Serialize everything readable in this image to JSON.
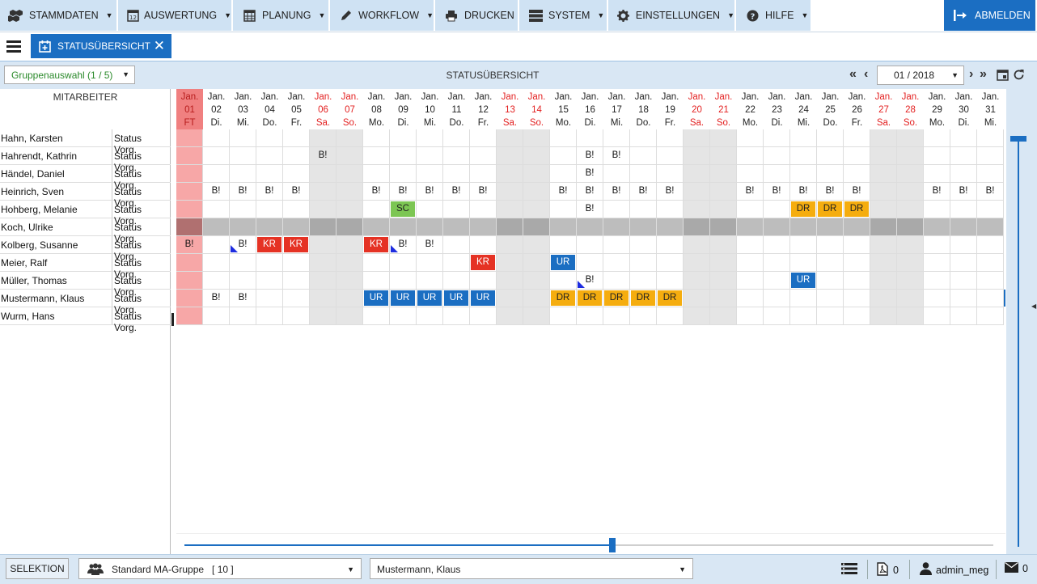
{
  "menu": [
    {
      "label": "STAMMDATEN",
      "icon": "cubes-icon",
      "dropdown": true
    },
    {
      "label": "AUSWERTUNG",
      "icon": "calendar-12-icon",
      "dropdown": true
    },
    {
      "label": "PLANUNG",
      "icon": "calendar-grid-icon",
      "dropdown": true
    },
    {
      "label": "WORKFLOW",
      "icon": "pencil-icon",
      "dropdown": true
    },
    {
      "label": "DRUCKEN",
      "icon": "printer-icon",
      "dropdown": false
    },
    {
      "label": "SYSTEM",
      "icon": "server-icon",
      "dropdown": true
    },
    {
      "label": "EINSTELLUNGEN",
      "icon": "gear-icon",
      "dropdown": true
    },
    {
      "label": "HILFE",
      "icon": "question-circle-icon",
      "dropdown": true
    }
  ],
  "logout_label": "ABMELDEN",
  "tab": {
    "label": "STATUSÜBERSICHT",
    "close": "✕"
  },
  "toolbar": {
    "group_select": "Gruppenauswahl (1 / 5)",
    "title": "STATUSÜBERSICHT",
    "month": "01 / 2018"
  },
  "employee_header": "MITARBEITER",
  "days": [
    {
      "m": "Jan.",
      "d": "01",
      "w": "FT",
      "type": "holiday"
    },
    {
      "m": "Jan.",
      "d": "02",
      "w": "Di.",
      "type": "work"
    },
    {
      "m": "Jan.",
      "d": "03",
      "w": "Mi.",
      "type": "work"
    },
    {
      "m": "Jan.",
      "d": "04",
      "w": "Do.",
      "type": "work"
    },
    {
      "m": "Jan.",
      "d": "05",
      "w": "Fr.",
      "type": "work"
    },
    {
      "m": "Jan.",
      "d": "06",
      "w": "Sa.",
      "type": "weekend"
    },
    {
      "m": "Jan.",
      "d": "07",
      "w": "So.",
      "type": "weekend"
    },
    {
      "m": "Jan.",
      "d": "08",
      "w": "Mo.",
      "type": "work"
    },
    {
      "m": "Jan.",
      "d": "09",
      "w": "Di.",
      "type": "work"
    },
    {
      "m": "Jan.",
      "d": "10",
      "w": "Mi.",
      "type": "work"
    },
    {
      "m": "Jan.",
      "d": "11",
      "w": "Do.",
      "type": "work"
    },
    {
      "m": "Jan.",
      "d": "12",
      "w": "Fr.",
      "type": "work"
    },
    {
      "m": "Jan.",
      "d": "13",
      "w": "Sa.",
      "type": "weekend"
    },
    {
      "m": "Jan.",
      "d": "14",
      "w": "So.",
      "type": "weekend"
    },
    {
      "m": "Jan.",
      "d": "15",
      "w": "Mo.",
      "type": "work"
    },
    {
      "m": "Jan.",
      "d": "16",
      "w": "Di.",
      "type": "work"
    },
    {
      "m": "Jan.",
      "d": "17",
      "w": "Mi.",
      "type": "work"
    },
    {
      "m": "Jan.",
      "d": "18",
      "w": "Do.",
      "type": "work"
    },
    {
      "m": "Jan.",
      "d": "19",
      "w": "Fr.",
      "type": "work"
    },
    {
      "m": "Jan.",
      "d": "20",
      "w": "Sa.",
      "type": "weekend"
    },
    {
      "m": "Jan.",
      "d": "21",
      "w": "So.",
      "type": "weekend"
    },
    {
      "m": "Jan.",
      "d": "22",
      "w": "Mo.",
      "type": "work"
    },
    {
      "m": "Jan.",
      "d": "23",
      "w": "Di.",
      "type": "work"
    },
    {
      "m": "Jan.",
      "d": "24",
      "w": "Mi.",
      "type": "work"
    },
    {
      "m": "Jan.",
      "d": "25",
      "w": "Do.",
      "type": "work"
    },
    {
      "m": "Jan.",
      "d": "26",
      "w": "Fr.",
      "type": "work"
    },
    {
      "m": "Jan.",
      "d": "27",
      "w": "Sa.",
      "type": "weekend"
    },
    {
      "m": "Jan.",
      "d": "28",
      "w": "So.",
      "type": "weekend"
    },
    {
      "m": "Jan.",
      "d": "29",
      "w": "Mo.",
      "type": "work"
    },
    {
      "m": "Jan.",
      "d": "30",
      "w": "Di.",
      "type": "work"
    },
    {
      "m": "Jan.",
      "d": "31",
      "w": "Mi.",
      "type": "work"
    }
  ],
  "employees": [
    {
      "name": "Hahn, Karsten",
      "status": "Status Vorg.",
      "entries": {}
    },
    {
      "name": "Hahrendt, Kathrin",
      "status": "Status Vorg.",
      "entries": {
        "06": "B!",
        "16": "B!",
        "17": "B!"
      }
    },
    {
      "name": "Händel, Daniel",
      "status": "Status Vorg.",
      "entries": {
        "16": "B!"
      }
    },
    {
      "name": "Heinrich, Sven",
      "status": "Status Vorg.",
      "entries": {
        "02": "B!",
        "03": "B!",
        "04": "B!",
        "05": "B!",
        "08": "B!",
        "09": "B!",
        "10": "B!",
        "11": "B!",
        "12": "B!",
        "15": "B!",
        "16": "B!",
        "17": "B!",
        "18": "B!",
        "19": "B!",
        "22": "B!",
        "23": "B!",
        "24": "B!",
        "25": "B!",
        "26": "B!",
        "29": "B!",
        "30": "B!",
        "31": "B!"
      }
    },
    {
      "name": "Hohberg, Melanie",
      "status": "Status Vorg.",
      "entries": {
        "09": "SC",
        "16": "B!",
        "24": "DR",
        "25": "DR",
        "26": "DR"
      }
    },
    {
      "name": "Koch, Ulrike",
      "status": "Status Vorg.",
      "entries": {},
      "inactive": true
    },
    {
      "name": "Kolberg, Susanne",
      "status": "Status Vorg.",
      "entries": {
        "01": "B!",
        "03": "B!",
        "04": "KR",
        "05": "KR",
        "08": "KR",
        "09": "B!",
        "10": "B!"
      },
      "markers": [
        "03",
        "09"
      ]
    },
    {
      "name": "Meier, Ralf",
      "status": "Status Vorg.",
      "entries": {
        "12": "KR",
        "15": "UR"
      }
    },
    {
      "name": "Müller, Thomas",
      "status": "Status Vorg.",
      "entries": {
        "16": "B!",
        "24": "UR"
      },
      "markers": [
        "16"
      ]
    },
    {
      "name": "Mustermann, Klaus",
      "status": "Status Vorg.",
      "entries": {
        "02": "B!",
        "03": "B!",
        "08": "UR",
        "09": "UR",
        "10": "UR",
        "11": "UR",
        "12": "UR",
        "15": "DR",
        "16": "DR",
        "17": "DR",
        "18": "DR",
        "19": "DR"
      }
    },
    {
      "name": "Wurm, Hans",
      "status": "Status Vorg.",
      "entries": {}
    }
  ],
  "statusbar": {
    "selection_label": "SELEKTION",
    "ma_group": "Standard MA-Gruppe   [ 10 ]",
    "person": "Mustermann, Klaus",
    "pdf_count": "0",
    "user": "admin_meg",
    "mail_count": "0"
  },
  "colors": {
    "accent": "#1b6ec2",
    "KR": "#e53224",
    "UR": "#1b6ec2",
    "DR": "#f5ad0f",
    "SC": "#7cc653",
    "holiday": "#f7a7a7",
    "weekend": "#e5e5e5"
  }
}
